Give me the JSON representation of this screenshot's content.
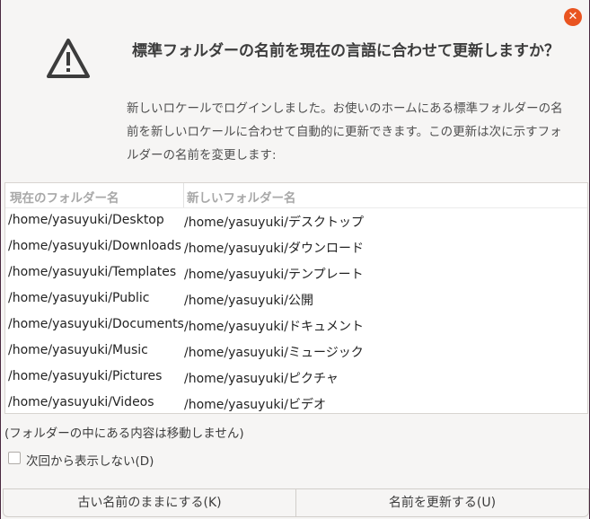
{
  "dialog": {
    "headline": "標準フォルダーの名前を現在の言語に合わせて更新しますか？",
    "message": "新しいロケールでログインしました。お使いのホームにある標準フォルダーの名前を新しいロケールに合わせて自動的に更新できます。この更新は次に示すフォルダーの名前を変更します:",
    "close_icon": "close-icon",
    "warning_icon": "warning-triangle-icon"
  },
  "table": {
    "columns": [
      "現在のフォルダー名",
      "新しいフォルダー名"
    ],
    "rows": [
      [
        "/home/yasuyuki/Desktop",
        "/home/yasuyuki/デスクトップ"
      ],
      [
        "/home/yasuyuki/Downloads",
        "/home/yasuyuki/ダウンロード"
      ],
      [
        "/home/yasuyuki/Templates",
        "/home/yasuyuki/テンプレート"
      ],
      [
        "/home/yasuyuki/Public",
        "/home/yasuyuki/公開"
      ],
      [
        "/home/yasuyuki/Documents",
        "/home/yasuyuki/ドキュメント"
      ],
      [
        "/home/yasuyuki/Music",
        "/home/yasuyuki/ミュージック"
      ],
      [
        "/home/yasuyuki/Pictures",
        "/home/yasuyuki/ピクチャ"
      ],
      [
        "/home/yasuyuki/Videos",
        "/home/yasuyuki/ビデオ"
      ]
    ]
  },
  "note": "(フォルダーの中にある内容は移動しません)",
  "checkbox": {
    "label": "次回から表示しない(D)",
    "checked": false
  },
  "buttons": {
    "keep_label": "古い名前のままにする(K)",
    "update_label": "名前を更新する(U)"
  },
  "colors": {
    "accent": "#e95420",
    "titlebar": "#2f2f2f"
  }
}
